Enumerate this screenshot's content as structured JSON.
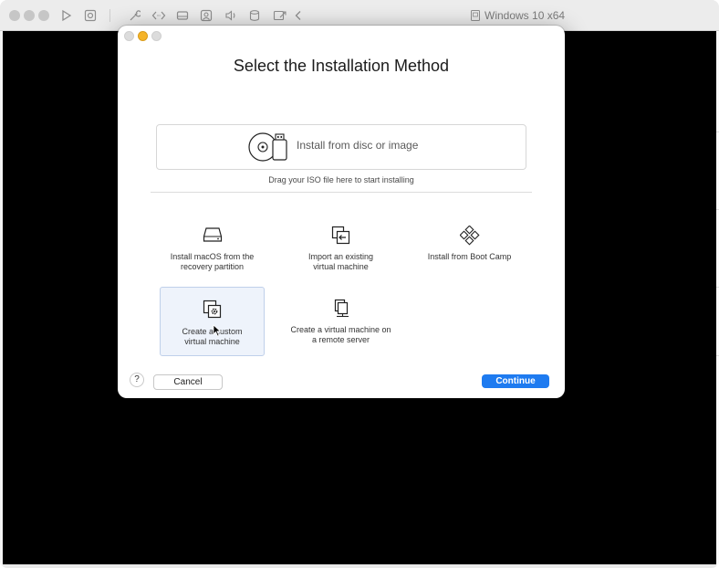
{
  "window": {
    "title": "Windows 10 x64"
  },
  "dialog": {
    "title": "Select the Installation Method",
    "disc_option": {
      "label": "Install from disc or image",
      "hint": "Drag your ISO file here to start installing"
    },
    "options": [
      {
        "label": "Install macOS from the\nrecovery partition",
        "icon": "drive-icon"
      },
      {
        "label": "Import an existing\nvirtual machine",
        "icon": "import-icon"
      },
      {
        "label": "Install from Boot Camp",
        "icon": "bootcamp-icon"
      },
      {
        "label": "Create a custom\nvirtual machine",
        "icon": "custom-vm-icon"
      },
      {
        "label": "Create a virtual machine on\na remote server",
        "icon": "remote-server-icon"
      }
    ],
    "help_label": "?",
    "cancel_label": "Cancel",
    "continue_label": "Continue"
  },
  "colors": {
    "accent": "#1e7bf0",
    "minimize": "#f5b429"
  }
}
